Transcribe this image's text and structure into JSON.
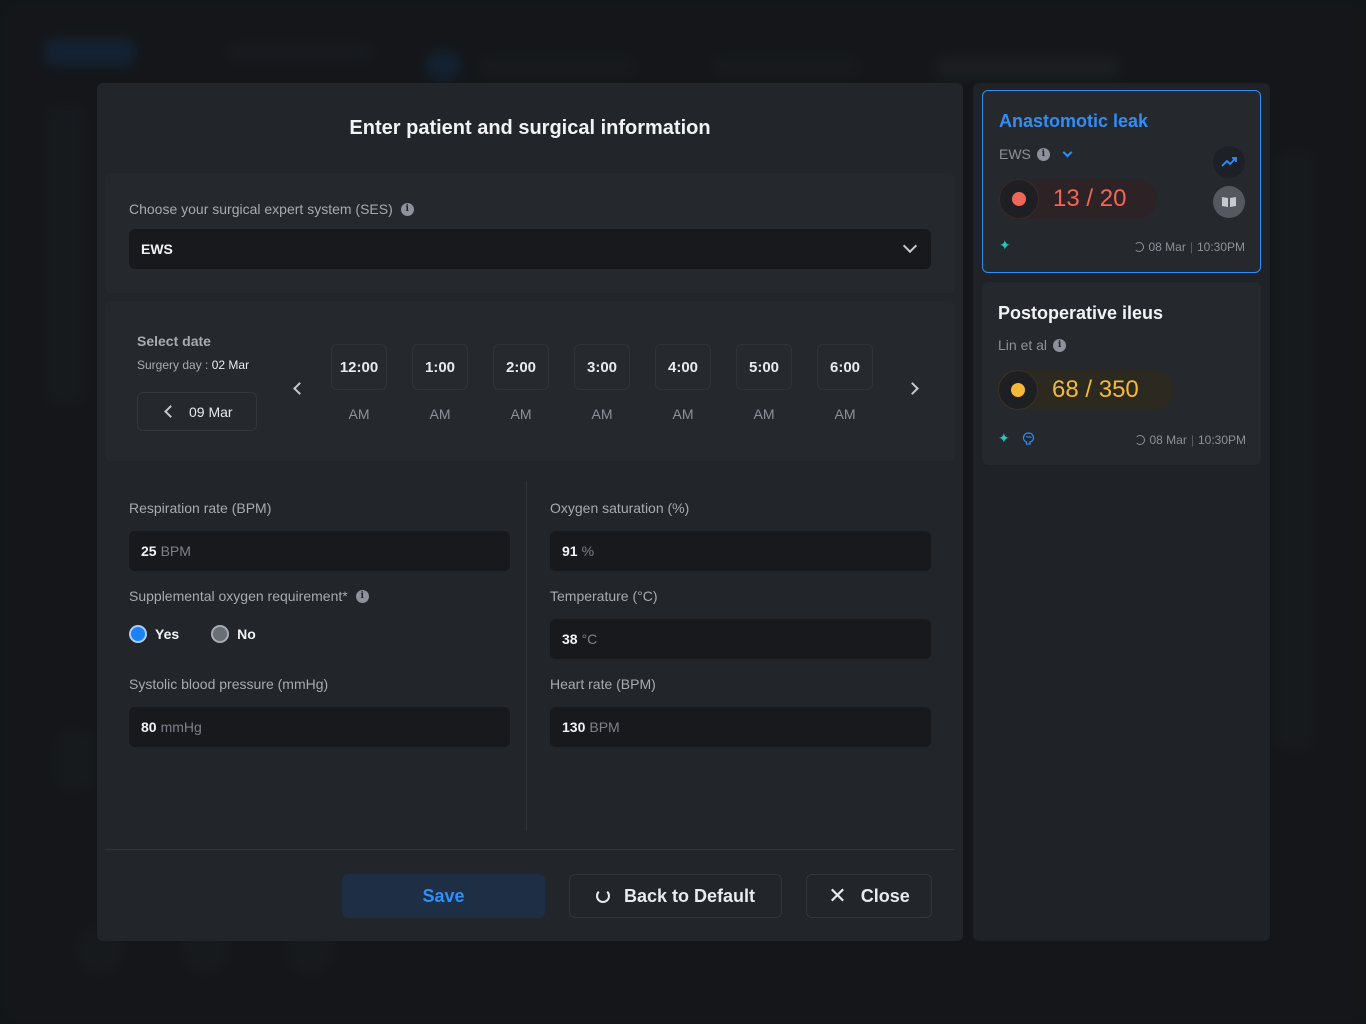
{
  "modal": {
    "title": "Enter patient and surgical information",
    "ses": {
      "label": "Choose your surgical expert system (SES)",
      "selected": "EWS"
    },
    "date": {
      "label": "Select date",
      "surgery_day_label": "Surgery day :",
      "surgery_day_value": "02 Mar",
      "current_date": "09 Mar",
      "times": [
        {
          "time": "12:00",
          "ampm": "AM"
        },
        {
          "time": "1:00",
          "ampm": "AM"
        },
        {
          "time": "2:00",
          "ampm": "AM"
        },
        {
          "time": "3:00",
          "ampm": "AM"
        },
        {
          "time": "4:00",
          "ampm": "AM"
        },
        {
          "time": "5:00",
          "ampm": "AM"
        },
        {
          "time": "6:00",
          "ampm": "AM"
        }
      ]
    },
    "fields": {
      "respiration": {
        "label": "Respiration rate (BPM)",
        "value": "25",
        "unit": "BPM"
      },
      "oxygen_requirement": {
        "label": "Supplemental oxygen requirement*",
        "yes": "Yes",
        "no": "No",
        "selected": "Yes"
      },
      "systolic": {
        "label": "Systolic blood pressure (mmHg)",
        "value": "80",
        "unit": "mmHg"
      },
      "oxygen_sat": {
        "label": "Oxygen saturation (%)",
        "value": "91",
        "unit": "%"
      },
      "temperature": {
        "label": "Temperature (°C)",
        "value": "38",
        "unit": "°C"
      },
      "heart_rate": {
        "label": "Heart rate (BPM)",
        "value": "130",
        "unit": "BPM"
      }
    },
    "buttons": {
      "save": "Save",
      "back_to_default": "Back to Default",
      "close": "Close"
    }
  },
  "cards": [
    {
      "title": "Anastomotic leak",
      "source": "EWS",
      "score": "13",
      "max": "20",
      "date": "08 Mar",
      "time": "10:30PM",
      "color": "#f0675a"
    },
    {
      "title": "Postoperative ileus",
      "source": "Lin et al",
      "score": "68",
      "max": "350",
      "date": "08 Mar",
      "time": "10:30PM",
      "color": "#f5b93a"
    }
  ],
  "colors": {
    "accent": "#2f8ef8",
    "background": "#22252a",
    "danger": "#f0675a",
    "warning": "#f5b93a",
    "teal": "#27c4c4"
  },
  "icons": [
    "info-icon",
    "chevron-down-icon",
    "chevron-left-icon",
    "chevron-right-icon",
    "refresh-icon",
    "close-icon",
    "trend-up-icon",
    "book-icon",
    "sparkle-icon",
    "brain-icon",
    "sync-icon"
  ]
}
